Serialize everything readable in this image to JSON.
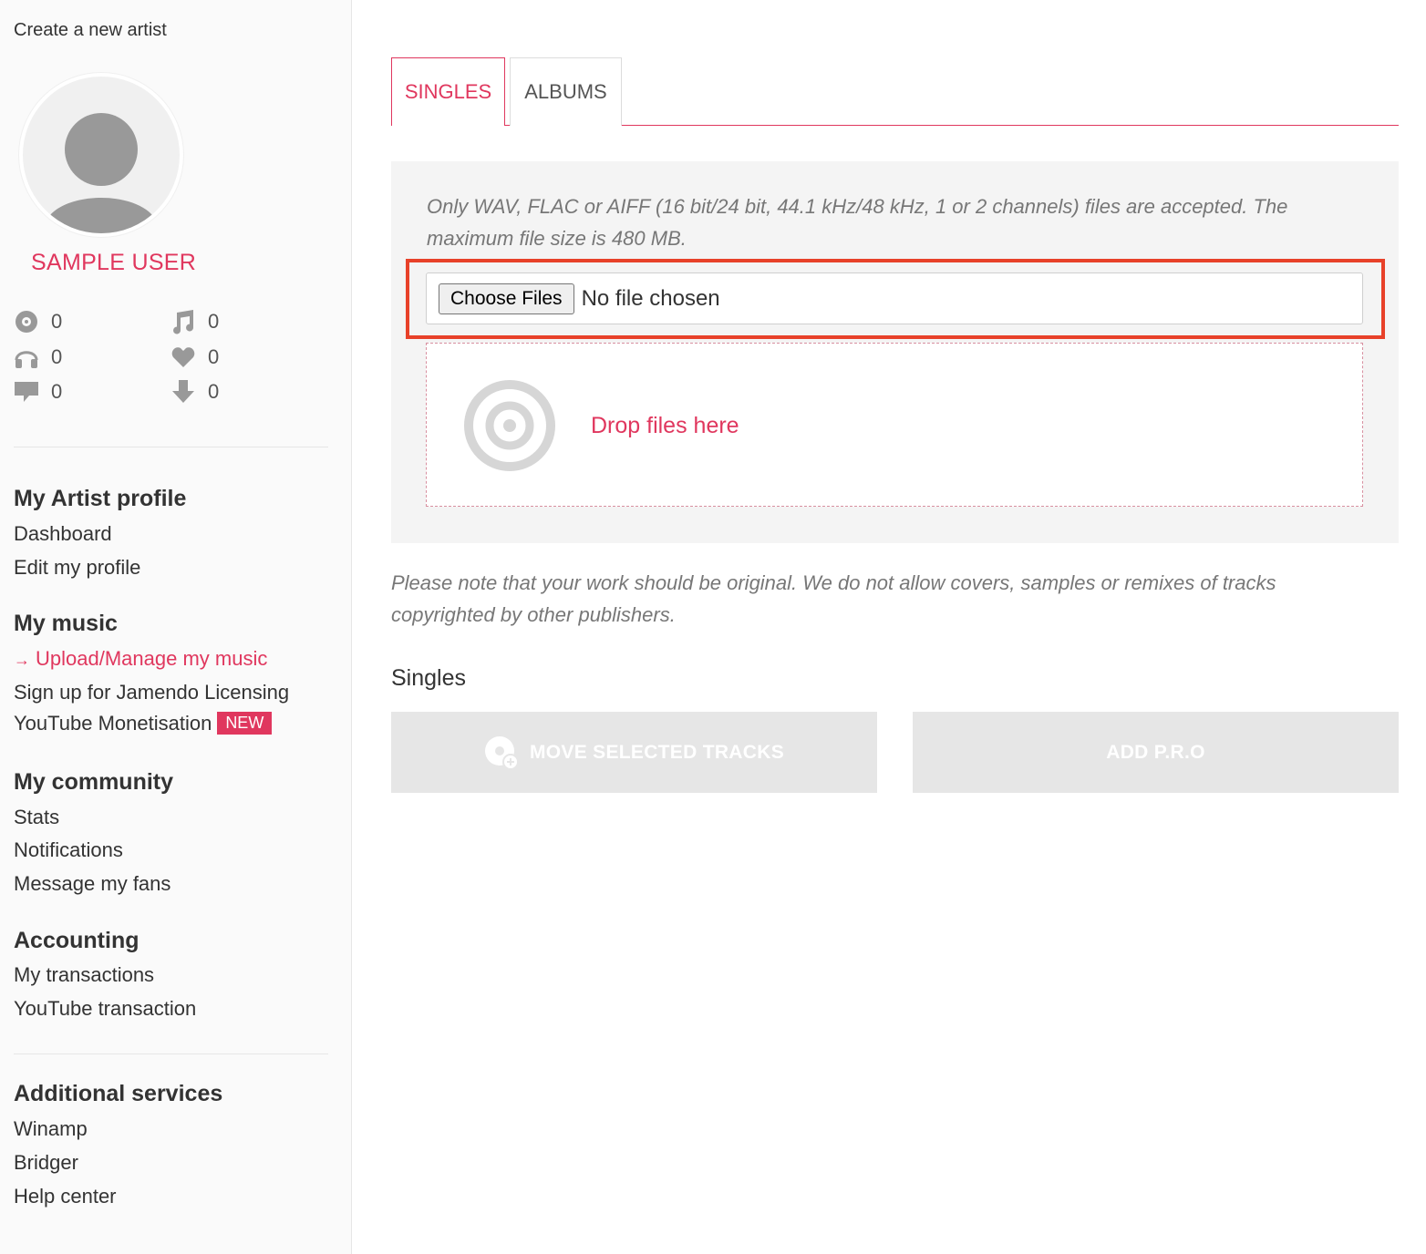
{
  "sidebar": {
    "create_artist": "Create a new artist",
    "username": "SAMPLE USER",
    "stats": [
      {
        "icon": "disc-icon",
        "value": "0"
      },
      {
        "icon": "music-note-icon",
        "value": "0"
      },
      {
        "icon": "headphones-icon",
        "value": "0"
      },
      {
        "icon": "heart-icon",
        "value": "0"
      },
      {
        "icon": "comment-icon",
        "value": "0"
      },
      {
        "icon": "download-icon",
        "value": "0"
      }
    ],
    "sections": {
      "artist_profile": {
        "heading": "My Artist profile",
        "items": [
          "Dashboard",
          "Edit my profile"
        ]
      },
      "music": {
        "heading": "My music",
        "items": [
          "Upload/Manage my music",
          "Sign up for Jamendo Licensing",
          "YouTube Monetisation"
        ],
        "active_arrow": "→",
        "badge": "NEW"
      },
      "community": {
        "heading": "My community",
        "items": [
          "Stats",
          "Notifications",
          "Message my fans"
        ]
      },
      "accounting": {
        "heading": "Accounting",
        "items": [
          "My transactions",
          "YouTube transaction"
        ]
      },
      "additional": {
        "heading": "Additional services",
        "items": [
          "Winamp",
          "Bridger",
          "Help center"
        ]
      }
    }
  },
  "main": {
    "tabs": [
      {
        "label": "SINGLES",
        "active": true
      },
      {
        "label": "ALBUMS",
        "active": false
      }
    ],
    "upload": {
      "accept_note": "Only WAV, FLAC or AIFF (16 bit/24 bit, 44.1 kHz/48 kHz, 1 or 2 channels) files are accepted. The maximum file size is 480 MB.",
      "choose_label": "Choose Files",
      "no_file": "No file chosen",
      "drop_text": "Drop files here"
    },
    "original_note": "Please note that your work should be original. We do not allow covers, samples or remixes of tracks copyrighted by other publishers.",
    "singles_title": "Singles",
    "buttons": {
      "move": "MOVE SELECTED TRACKS",
      "add_pro": "ADD P.R.O"
    }
  },
  "colors": {
    "accent": "#e0375e",
    "highlight": "#e84129",
    "panel": "#f4f4f4",
    "disabled_button": "#e6e6e6"
  }
}
